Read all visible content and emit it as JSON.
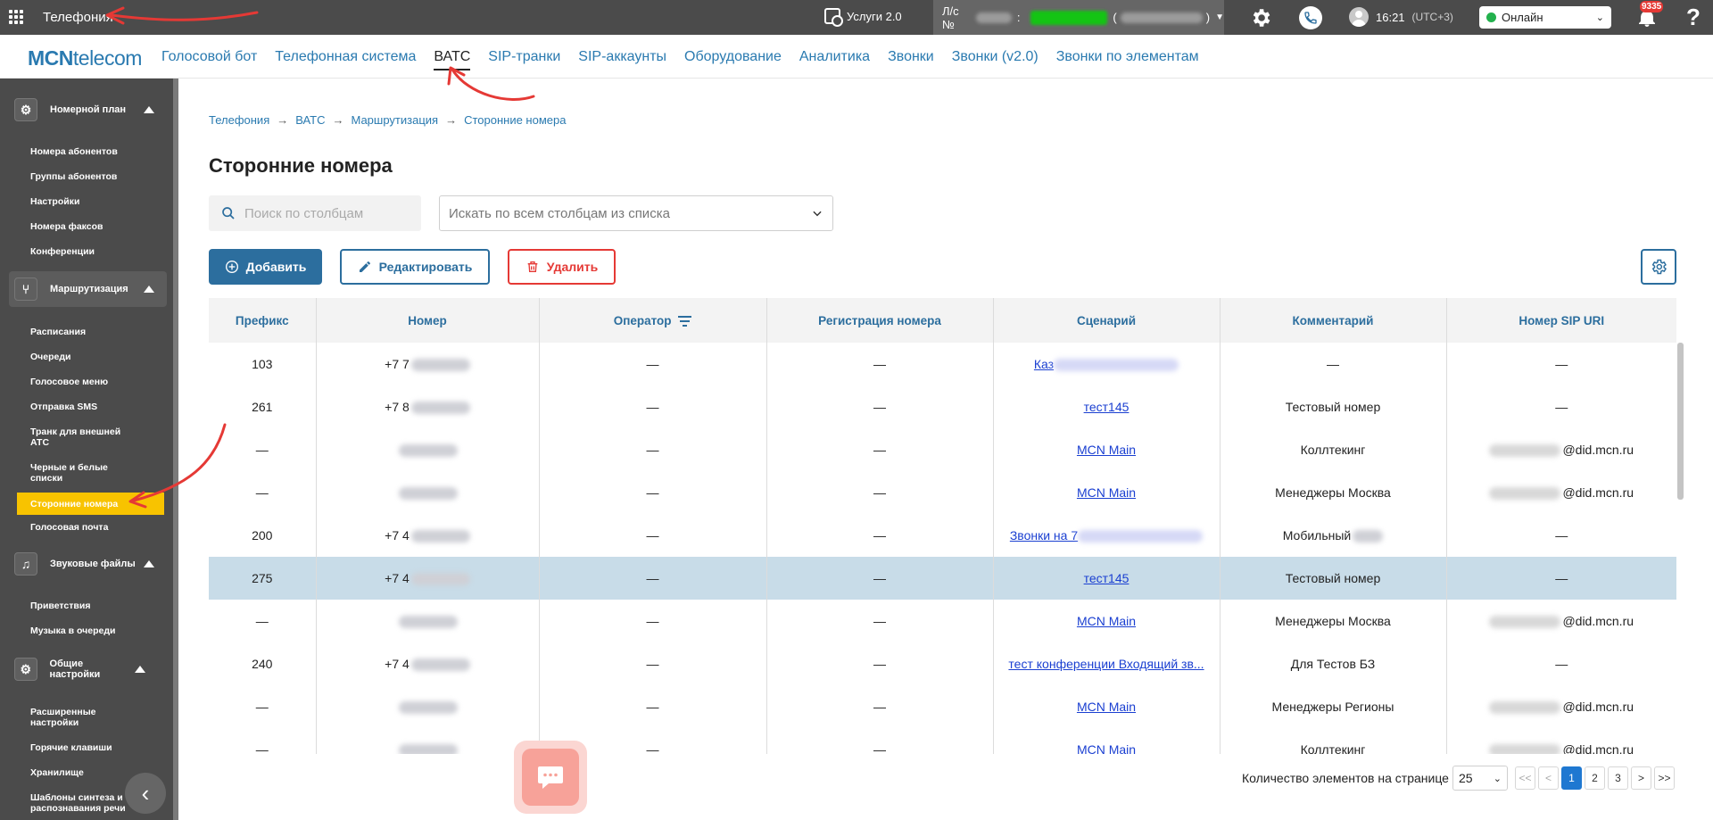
{
  "topbar": {
    "app_title": "Телефония",
    "services_label": "Услуги 2.0",
    "account_label": "Л/с №",
    "account_colon": ":",
    "account_name_open": "(",
    "account_name_close": ")",
    "time": "16:21",
    "timezone": "(UTC+3)",
    "status": "Онлайн",
    "notifications_count": "9335",
    "help": "?"
  },
  "logo": {
    "bold": "MCN",
    "rest": "telecom"
  },
  "nav": [
    {
      "label": "Голосовой бот"
    },
    {
      "label": "Телефонная система"
    },
    {
      "label": "ВАТС"
    },
    {
      "label": "SIP-транки"
    },
    {
      "label": "SIP-аккаунты"
    },
    {
      "label": "Оборудование"
    },
    {
      "label": "Аналитика"
    },
    {
      "label": "Звонки"
    },
    {
      "label": "Звонки (v2.0)"
    },
    {
      "label": "Звонки по элементам"
    }
  ],
  "sidebar": {
    "groups": [
      {
        "label": "Номерной план",
        "items": [
          "Номера абонентов",
          "Группы абонентов",
          "Настройки",
          "Номера факсов",
          "Конференции"
        ]
      },
      {
        "label": "Маршрутизация",
        "items": [
          "Расписания",
          "Очереди",
          "Голосовое меню",
          "Отправка SMS",
          "Транк для внешней АТС",
          "Черные и белые списки",
          "Сторонние номера",
          "Голосовая почта"
        ]
      },
      {
        "label": "Звуковые файлы",
        "items": [
          "Приветствия",
          "Музыка в очереди"
        ]
      },
      {
        "label": "Общие настройки",
        "items": [
          "Расширенные настройки",
          "Горячие клавиши",
          "Хранилище",
          "Шаблоны синтеза и распознавания речи"
        ]
      }
    ]
  },
  "breadcrumb": [
    "Телефония",
    "ВАТС",
    "Маршрутизация",
    "Сторонние номера"
  ],
  "breadcrumb_sep": "→",
  "page_title": "Сторонние номера",
  "search": {
    "placeholder": "Поиск по столбцам",
    "value": ""
  },
  "column_filter": {
    "placeholder": "Искать по всем столбцам из списка"
  },
  "buttons": {
    "add": "Добавить",
    "edit": "Редактировать",
    "delete": "Удалить"
  },
  "table": {
    "columns": [
      "Префикс",
      "Номер",
      "Оператор",
      "Регистрация номера",
      "Сценарий",
      "Комментарий",
      "Номер SIP URI"
    ],
    "rows": [
      {
        "prefix": "103",
        "number": "+7 7",
        "operator": "—",
        "registration": "—",
        "scenario": "Каз",
        "comment": "—",
        "sip": "—"
      },
      {
        "prefix": "261",
        "number": "+7 8",
        "operator": "—",
        "registration": "—",
        "scenario": "тест145",
        "comment": "Тестовый номер",
        "sip": "—"
      },
      {
        "prefix": "—",
        "number": "",
        "operator": "—",
        "registration": "—",
        "scenario": "MCN Main",
        "comment": "Коллтекинг",
        "sip": "@did.mcn.ru"
      },
      {
        "prefix": "—",
        "number": "",
        "operator": "—",
        "registration": "—",
        "scenario": "MCN Main",
        "comment": "Менеджеры Москва",
        "sip": "@did.mcn.ru"
      },
      {
        "prefix": "200",
        "number": "+7 4",
        "operator": "—",
        "registration": "—",
        "scenario": "Звонки на 7",
        "comment": "Мобильный",
        "sip": "—"
      },
      {
        "prefix": "275",
        "number": "+7 4",
        "operator": "—",
        "registration": "—",
        "scenario": "тест145",
        "comment": "Тестовый номер",
        "sip": "—"
      },
      {
        "prefix": "—",
        "number": "",
        "operator": "—",
        "registration": "—",
        "scenario": "MCN Main",
        "comment": "Менеджеры Москва",
        "sip": "@did.mcn.ru"
      },
      {
        "prefix": "240",
        "number": "+7 4",
        "operator": "—",
        "registration": "—",
        "scenario": "тест конференции Входящий зв...",
        "comment": "Для Тестов БЗ",
        "sip": "—"
      },
      {
        "prefix": "—",
        "number": "",
        "operator": "—",
        "registration": "—",
        "scenario": "MCN Main",
        "comment": "Менеджеры Регионы",
        "sip": "@did.mcn.ru"
      },
      {
        "prefix": "—",
        "number": "",
        "operator": "—",
        "registration": "—",
        "scenario": "MCN Main",
        "comment": "Коллтекинг",
        "sip": "@did.mcn.ru"
      }
    ],
    "selected_row": 5
  },
  "pagination": {
    "page_size_label": "Количество элементов на странице",
    "page_size": "25",
    "first": "<<",
    "prev": "<",
    "pages": [
      "1",
      "2",
      "3"
    ],
    "current": "1",
    "next": ">",
    "last": ">>"
  },
  "colors": {
    "accent": "#2c6e9e",
    "danger": "#e53935",
    "active_menu": "#f8c300",
    "topbar": "#4b4b4b"
  }
}
